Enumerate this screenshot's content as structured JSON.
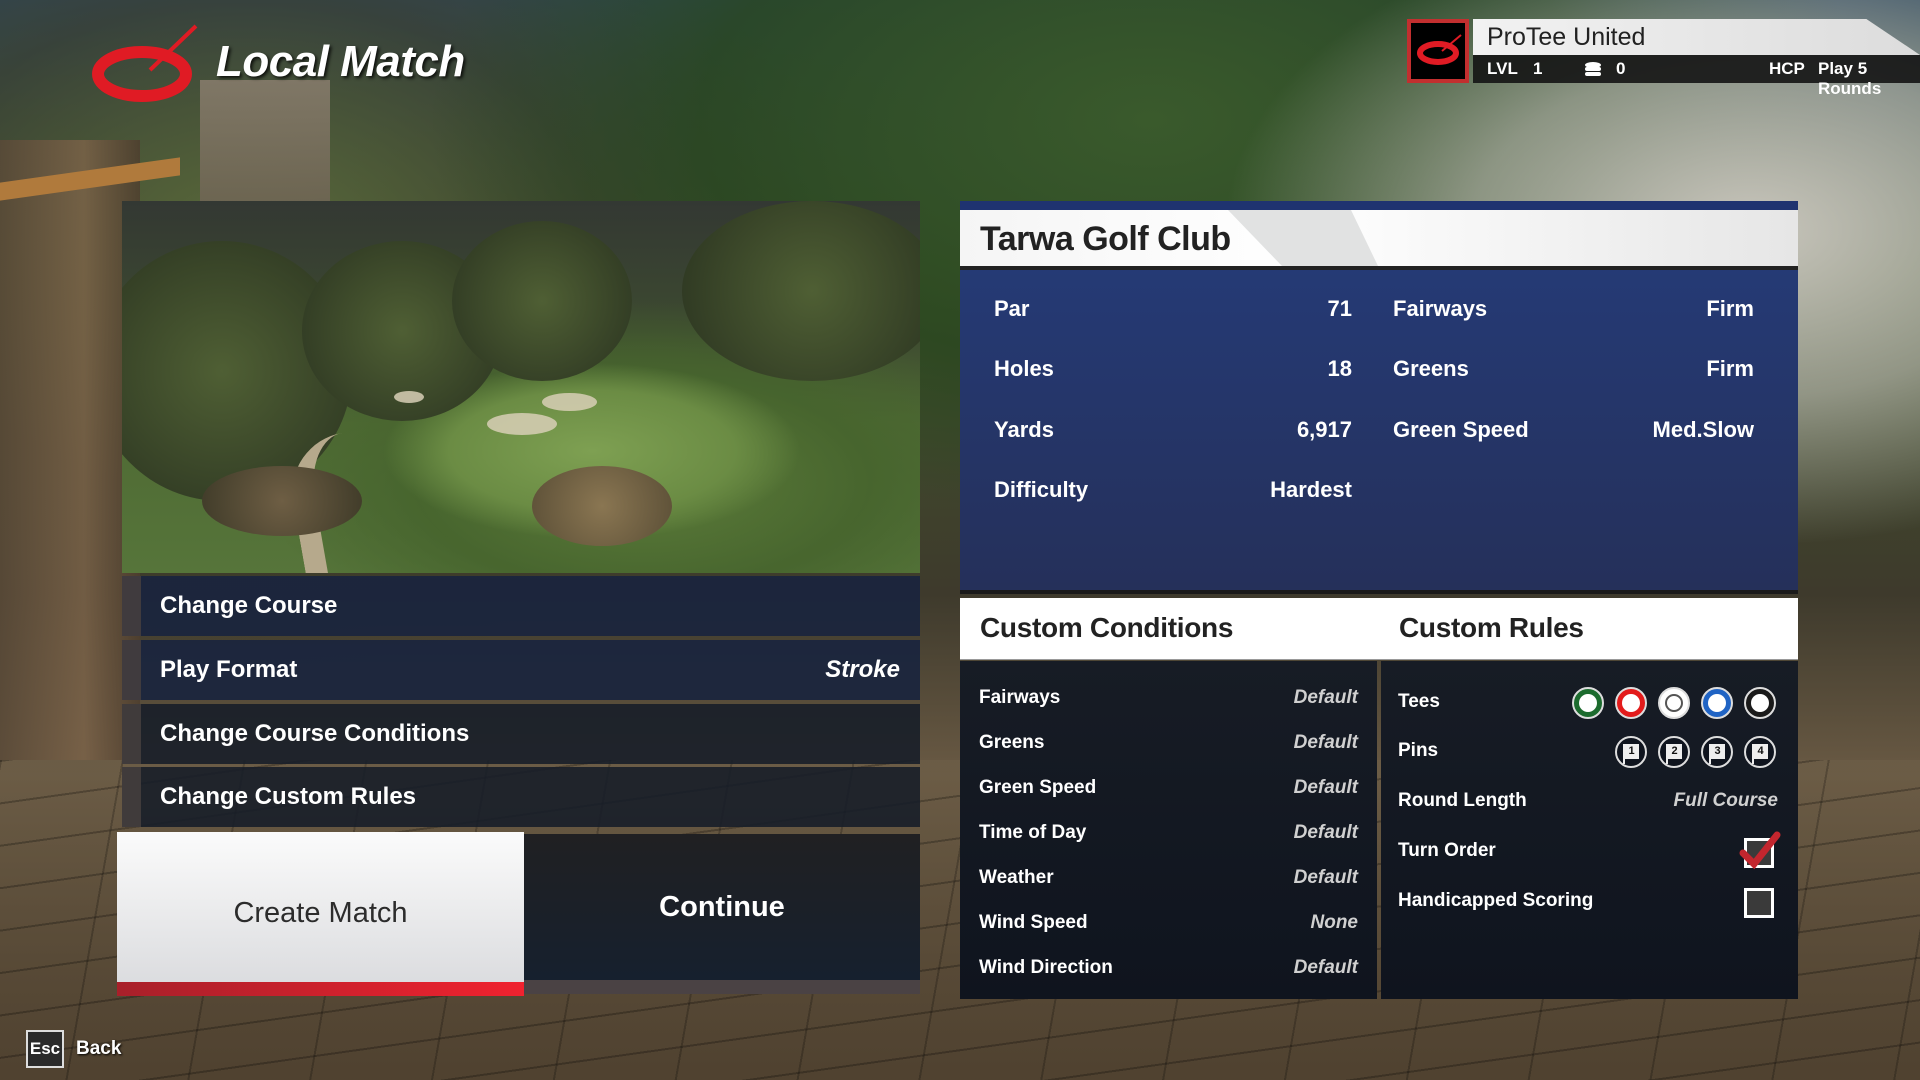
{
  "header": {
    "title": "Local Match",
    "logo_icon": "protee-swoosh-icon"
  },
  "profile": {
    "name": "ProTee United",
    "level_label": "LVL",
    "level_value": "1",
    "coin_icon": "coins-icon",
    "coins_value": "0",
    "hcp_label": "HCP",
    "hcp_value": "Play 5 Rounds"
  },
  "left_menu": {
    "items": [
      {
        "label": "Change Course",
        "value": ""
      },
      {
        "label": "Play Format",
        "value": "Stroke"
      },
      {
        "label": "Change Course Conditions",
        "value": ""
      },
      {
        "label": "Change Custom Rules",
        "value": ""
      }
    ],
    "create_match_label": "Create Match",
    "continue_label": "Continue"
  },
  "course": {
    "name": "Tarwa Golf Club",
    "stats_left": [
      {
        "label": "Par",
        "value": "71"
      },
      {
        "label": "Holes",
        "value": "18"
      },
      {
        "label": "Yards",
        "value": "6,917"
      },
      {
        "label": "Difficulty",
        "value": "Hardest"
      }
    ],
    "stats_right": [
      {
        "label": "Fairways",
        "value": "Firm"
      },
      {
        "label": "Greens",
        "value": "Firm"
      },
      {
        "label": "Green Speed",
        "value": "Med.Slow"
      }
    ]
  },
  "custom_conditions": {
    "title": "Custom Conditions",
    "rows": [
      {
        "label": "Fairways",
        "value": "Default"
      },
      {
        "label": "Greens",
        "value": "Default"
      },
      {
        "label": "Green Speed",
        "value": "Default"
      },
      {
        "label": "Time of Day",
        "value": "Default"
      },
      {
        "label": "Weather",
        "value": "Default"
      },
      {
        "label": "Wind Speed",
        "value": "None"
      },
      {
        "label": "Wind Direction",
        "value": "Default"
      }
    ]
  },
  "custom_rules": {
    "title": "Custom Rules",
    "tees_label": "Tees",
    "tees": [
      {
        "name": "green-tee",
        "color": "#1c6b2e"
      },
      {
        "name": "red-tee",
        "color": "#e31b1b"
      },
      {
        "name": "white-tee",
        "color": "#ffffff"
      },
      {
        "name": "blue-tee",
        "color": "#1f63c4"
      },
      {
        "name": "black-tee",
        "color": "#1a1a1a"
      }
    ],
    "pins_label": "Pins",
    "pins": [
      "1",
      "2",
      "3",
      "4"
    ],
    "round_length_label": "Round Length",
    "round_length_value": "Full Course",
    "turn_order_label": "Turn Order",
    "turn_order_checked": true,
    "handicapped_label": "Handicapped Scoring",
    "handicapped_checked": false
  },
  "footer": {
    "esc_key": "Esc",
    "back_label": "Back"
  },
  "colors": {
    "accent_red": "#e8222e",
    "panel_blue": "#253a75",
    "panel_dark": "#141a24"
  }
}
